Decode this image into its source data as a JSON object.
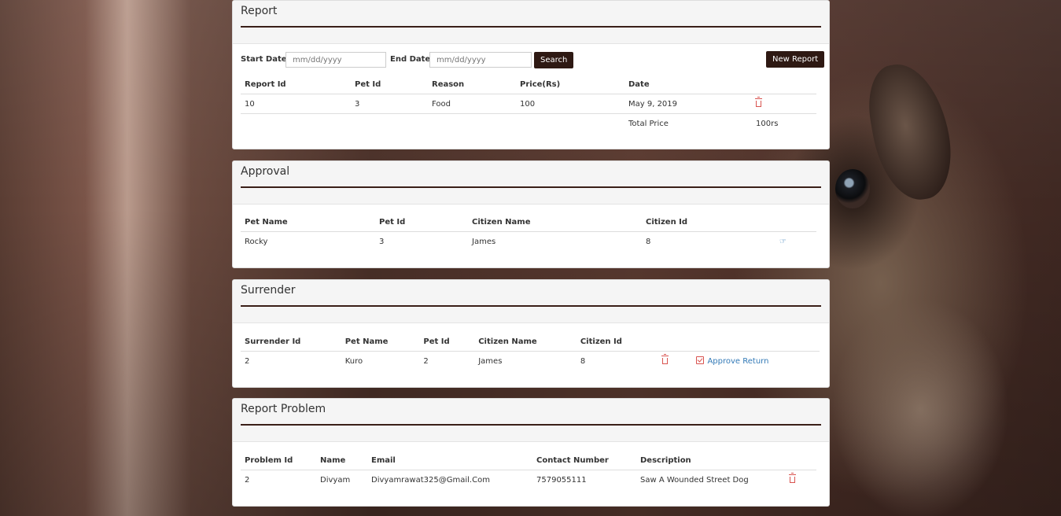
{
  "report": {
    "title": "Report",
    "start_label": "Start Date",
    "end_label": "End Date",
    "start_placeholder": "mm/dd/yyyy",
    "end_placeholder": "mm/dd/yyyy",
    "search_label": "Search",
    "new_report_label": "New Report",
    "columns": [
      "Report Id",
      "Pet Id",
      "Reason",
      "Price(Rs)",
      "Date"
    ],
    "rows": [
      {
        "report_id": "10",
        "pet_id": "3",
        "reason": "Food",
        "price": "100",
        "date": "May 9, 2019"
      }
    ],
    "total_label": "Total Price",
    "total_value": "100rs"
  },
  "approval": {
    "title": "Approval",
    "columns": [
      "Pet Name",
      "Pet Id",
      "Citizen Name",
      "Citizen Id"
    ],
    "rows": [
      {
        "pet_name": "Rocky",
        "pet_id": "3",
        "citizen_name": "James",
        "citizen_id": "8"
      }
    ]
  },
  "surrender": {
    "title": "Surrender",
    "columns": [
      "Surrender Id",
      "Pet Name",
      "Pet Id",
      "Citizen Name",
      "Citizen Id"
    ],
    "rows": [
      {
        "surrender_id": "2",
        "pet_name": "Kuro",
        "pet_id": "2",
        "citizen_name": "James",
        "citizen_id": "8",
        "action_label": "Approve Return"
      }
    ]
  },
  "problem": {
    "title": "Report Problem",
    "columns": [
      "Problem Id",
      "Name",
      "Email",
      "Contact Number",
      "Description"
    ],
    "rows": [
      {
        "problem_id": "2",
        "name": "Divyam",
        "email": "Divyamrawat325@Gmail.Com",
        "contact": "7579055111",
        "description": "Saw A Wounded Street Dog"
      }
    ]
  },
  "colors": {
    "accent_dark": "#2e1913",
    "rule": "#3a1f18",
    "delete_red": "#d9534f",
    "link_blue": "#337ab7"
  },
  "icons": [
    "trash-icon",
    "hand-point-icon",
    "check-square-icon"
  ]
}
